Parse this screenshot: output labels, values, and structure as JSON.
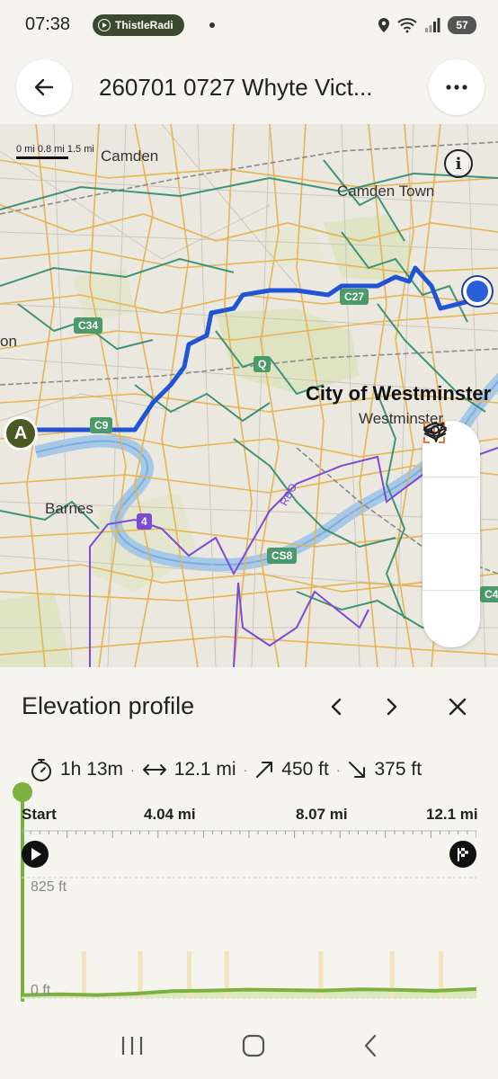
{
  "status": {
    "time": "07:38",
    "radio_label": "ThistleRadi",
    "battery": "57"
  },
  "header": {
    "title": "260701 0727 Whyte Vict...",
    "back_icon": "arrow-left-icon",
    "more_icon": "more-horizontal-icon"
  },
  "map": {
    "scale_label": "0 mi   0.8 mi 1.5 mi",
    "places": {
      "camden": "Camden Town",
      "camden_partial": "Camden",
      "westminster_city": "City of Westminster",
      "westminster": "Westminster",
      "barnes": "Barnes",
      "left_partial": "on"
    },
    "routes": {
      "c27": "C27",
      "c34": "C34",
      "c9": "C9",
      "q": "Q",
      "cs8": "CS8",
      "four": "4",
      "c4": "C4",
      "rbo": "RBO"
    },
    "start_marker": "A",
    "info_label": "i",
    "tools": [
      "eye-icon",
      "recenter-icon",
      "layers-icon",
      "navigate-icon"
    ]
  },
  "elevation": {
    "title": "Elevation profile",
    "stats": {
      "duration": "1h 13m",
      "distance": "12.1 mi",
      "ascent": "450 ft",
      "descent": "375 ft"
    },
    "axis": [
      "Start",
      "4.04 mi",
      "8.07 mi",
      "12.1 mi"
    ],
    "y_top": "825 ft",
    "y_bottom": "0 ft",
    "accent": "#7bb23f"
  },
  "chart_data": {
    "type": "area",
    "title": "Elevation profile",
    "xlabel": "",
    "ylabel": "",
    "x": [
      0,
      1,
      2,
      3,
      4,
      5,
      6,
      7,
      8,
      9,
      10,
      11,
      12.1
    ],
    "y": [
      20,
      26,
      21,
      30,
      48,
      52,
      58,
      55,
      52,
      60,
      56,
      50,
      62
    ],
    "ylim": [
      0,
      825
    ],
    "xlim": [
      0,
      12.1
    ]
  }
}
